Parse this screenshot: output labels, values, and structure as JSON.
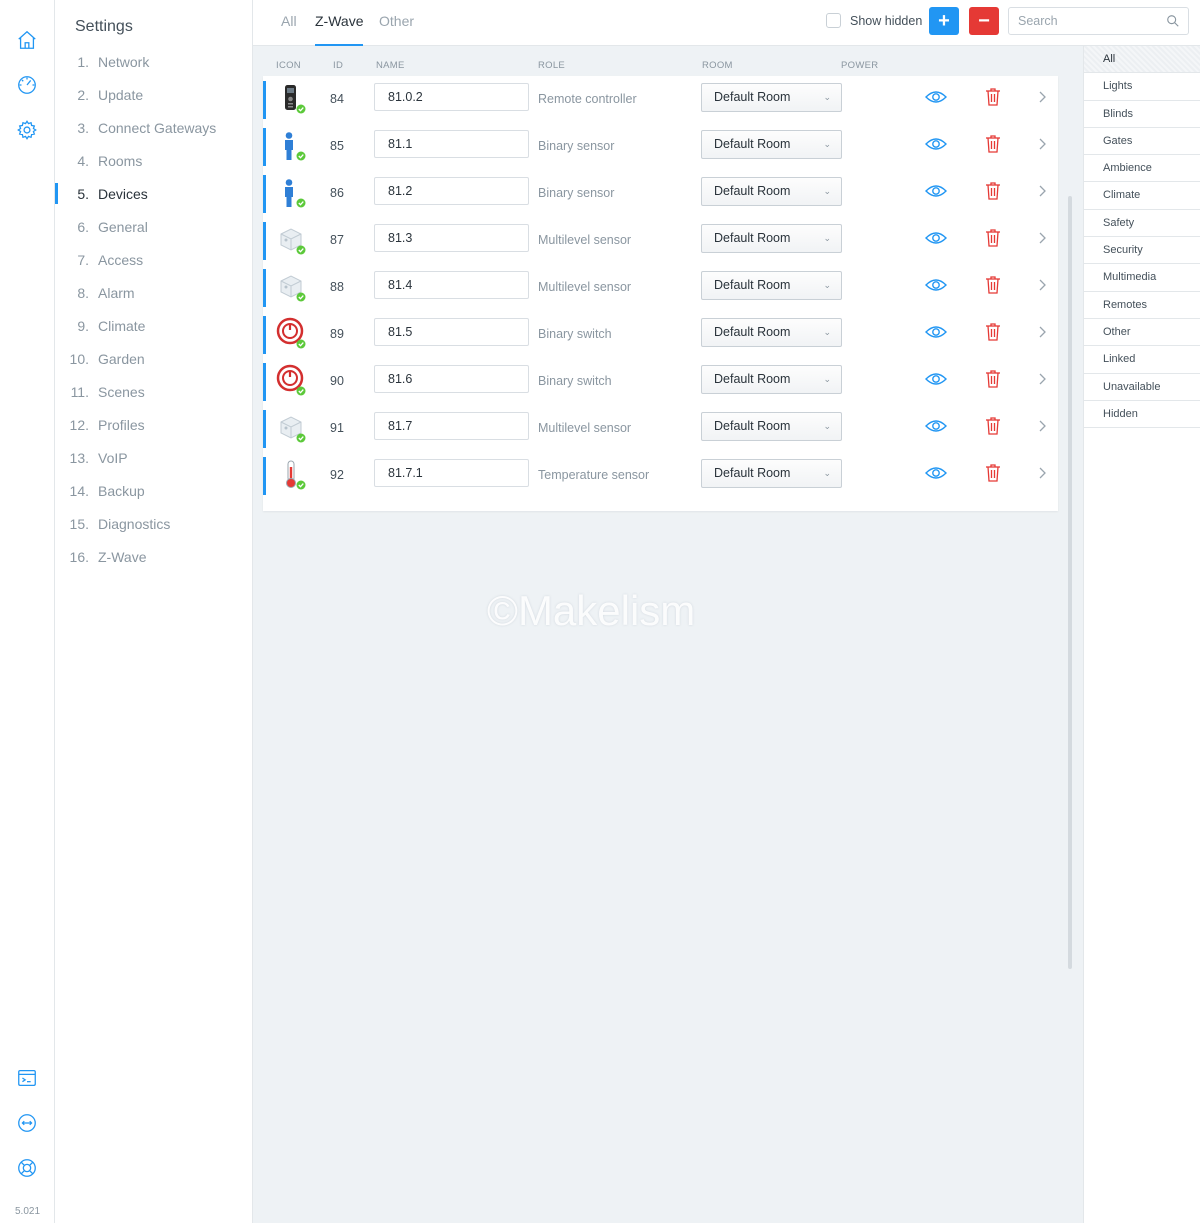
{
  "rail": {
    "top_icons": [
      "home-icon",
      "dashboard-gauge-icon",
      "settings-gear-icon"
    ],
    "bottom_icons": [
      "terminal-icon",
      "remote-access-icon",
      "support-lifebuoy-icon"
    ],
    "version": "5.021",
    "accent": "#2196f3"
  },
  "menu": {
    "title": "Settings",
    "items": [
      {
        "num": "1.",
        "label": "Network"
      },
      {
        "num": "2.",
        "label": "Update"
      },
      {
        "num": "3.",
        "label": "Connect Gateways"
      },
      {
        "num": "4.",
        "label": "Rooms"
      },
      {
        "num": "5.",
        "label": "Devices",
        "active": true
      },
      {
        "num": "6.",
        "label": "General"
      },
      {
        "num": "7.",
        "label": "Access"
      },
      {
        "num": "8.",
        "label": "Alarm"
      },
      {
        "num": "9.",
        "label": "Climate"
      },
      {
        "num": "10.",
        "label": "Garden"
      },
      {
        "num": "11.",
        "label": "Scenes"
      },
      {
        "num": "12.",
        "label": "Profiles"
      },
      {
        "num": "13.",
        "label": "VoIP"
      },
      {
        "num": "14.",
        "label": "Backup"
      },
      {
        "num": "15.",
        "label": "Diagnostics"
      },
      {
        "num": "16.",
        "label": "Z-Wave"
      }
    ]
  },
  "tabs": [
    {
      "label": "All"
    },
    {
      "label": "Z-Wave",
      "active": true
    },
    {
      "label": "Other"
    }
  ],
  "toolbar": {
    "show_hidden_label": "Show hidden",
    "show_hidden_checked": false,
    "add_symbol": "+",
    "remove_symbol": "−",
    "search_placeholder": "Search",
    "add_color": "#2196f3",
    "remove_color": "#e53935"
  },
  "columns": {
    "icon": "ICON",
    "id": "ID",
    "name": "NAME",
    "role": "ROLE",
    "room": "ROOM",
    "power": "POWER"
  },
  "devices": [
    {
      "icon": "remote-controller-icon",
      "id": "84",
      "name": "81.0.2",
      "role": "Remote controller",
      "room": "Default Room"
    },
    {
      "icon": "binary-sensor-person-icon",
      "id": "85",
      "name": "81.1",
      "role": "Binary sensor",
      "room": "Default Room"
    },
    {
      "icon": "binary-sensor-person-icon",
      "id": "86",
      "name": "81.2",
      "role": "Binary sensor",
      "room": "Default Room"
    },
    {
      "icon": "multilevel-sensor-cube-icon",
      "id": "87",
      "name": "81.3",
      "role": "Multilevel sensor",
      "room": "Default Room"
    },
    {
      "icon": "multilevel-sensor-cube-icon",
      "id": "88",
      "name": "81.4",
      "role": "Multilevel sensor",
      "room": "Default Room"
    },
    {
      "icon": "power-switch-icon",
      "id": "89",
      "name": "81.5",
      "role": "Binary switch",
      "room": "Default Room"
    },
    {
      "icon": "power-switch-icon",
      "id": "90",
      "name": "81.6",
      "role": "Binary switch",
      "room": "Default Room"
    },
    {
      "icon": "multilevel-sensor-cube-icon",
      "id": "91",
      "name": "81.7",
      "role": "Multilevel sensor",
      "room": "Default Room"
    },
    {
      "icon": "thermometer-icon",
      "id": "92",
      "name": "81.7.1",
      "role": "Temperature sensor",
      "room": "Default Room"
    }
  ],
  "watermark": "©Makelism",
  "categories": [
    {
      "label": "All",
      "active": true
    },
    {
      "label": "Lights"
    },
    {
      "label": "Blinds"
    },
    {
      "label": "Gates"
    },
    {
      "label": "Ambience"
    },
    {
      "label": "Climate"
    },
    {
      "label": "Safety"
    },
    {
      "label": "Security"
    },
    {
      "label": "Multimedia"
    },
    {
      "label": "Remotes"
    },
    {
      "label": "Other"
    },
    {
      "label": "Linked"
    },
    {
      "label": "Unavailable"
    },
    {
      "label": "Hidden"
    }
  ]
}
